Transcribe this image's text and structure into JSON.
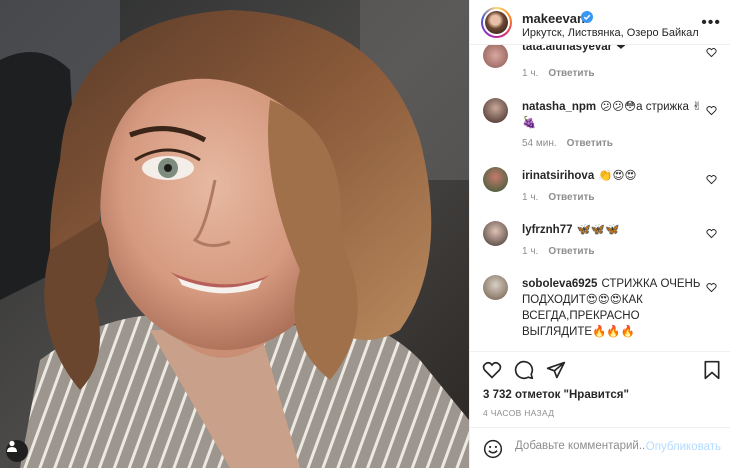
{
  "post": {
    "username": "makeevan",
    "location": "Иркутск, Листвянка, Озеро Байкал",
    "more_icon": "ellipsis-icon"
  },
  "comments": [
    {
      "user": "tata.alunasyevar",
      "text": "❤",
      "time": "1 ч.",
      "reply": "Ответить"
    },
    {
      "user": "natasha_npm",
      "text": "😕😕😳а стрижка ✌🍇",
      "time": "54 мин.",
      "reply": "Ответить"
    },
    {
      "user": "irinatsirihova",
      "text": "👏😍😍",
      "time": "1 ч.",
      "reply": "Ответить"
    },
    {
      "user": "lyfrznh77",
      "text": "🦋🦋🦋",
      "time": "1 ч.",
      "reply": "Ответить"
    },
    {
      "user": "soboleva6925",
      "text": "СТРИЖКА ОЧЕНЬ ПОДХОДИТ😍😍😍КАК ВСЕГДА,ПРЕКРАСНО ВЫГЛЯДИТЕ🔥🔥🔥",
      "time": "",
      "reply": ""
    }
  ],
  "stats": {
    "likes": "3 732 отметок \"Нравится\"",
    "time_ago": "4 ЧАСОВ НАЗАД"
  },
  "add_comment": {
    "placeholder": "Добавьте комментарий...",
    "publish": "Опубликовать"
  },
  "colors": {
    "accent": "#0095f6",
    "publish_disabled": "#b3dbff",
    "meta": "#8e8e8e",
    "text": "#262626"
  }
}
